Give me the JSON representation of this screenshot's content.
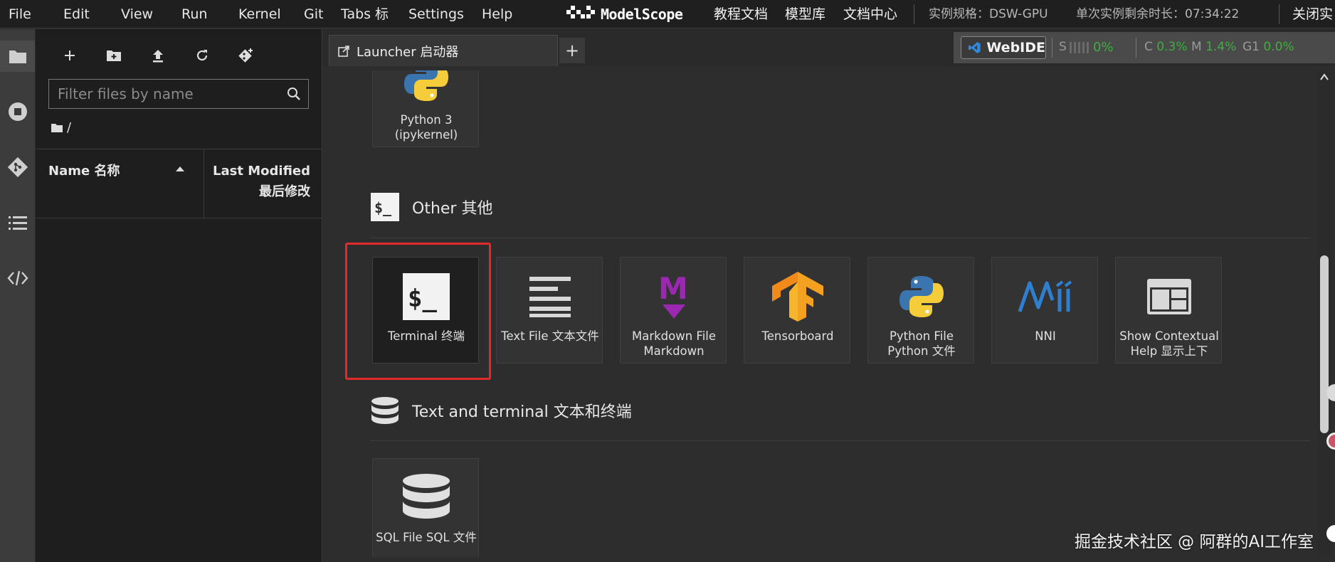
{
  "menubar": {
    "items": [
      "File",
      "Edit",
      "View",
      "Run",
      "Kernel",
      "Git",
      "Tabs",
      "标",
      "Settings",
      "Help"
    ],
    "brand": "ModelScope",
    "links": [
      "教程文档",
      "模型库",
      "文档中心"
    ],
    "instance_spec": "实例规格：DSW-GPU",
    "time_left": "单次实例剩余时长：07:34:22",
    "close_label": "关闭实"
  },
  "filebrowser": {
    "filter_placeholder": "Filter files by name",
    "breadcrumb": "/",
    "col_name": "Name  名称",
    "col_modified": "Last Modified  最后修改"
  },
  "tab": {
    "label": "Launcher  启动器",
    "add": "+"
  },
  "status": {
    "webide": "WebIDE",
    "s_label": "S",
    "s_value": "0%",
    "c_label": "C",
    "c_value": "0.3%",
    "m_label": "M",
    "m_value": "1.4%",
    "g_label": "G1",
    "g_value": "0.0%"
  },
  "launcher": {
    "notebook_card": "Python 3 (ipykernel)",
    "other_section": "Other  其他",
    "other_cards": [
      "Terminal  终端",
      "Text File  文本文件",
      "Markdown File  Markdown",
      "Tensorboard",
      "Python File  Python 文件",
      "NNI",
      "Show Contextual Help  显示上下"
    ],
    "text_terminal_section": "Text and terminal  文本和终端",
    "sql_card": "SQL File  SQL 文件"
  },
  "watermark": "掘金技术社区 @ 阿群的AI工作室",
  "colors": {
    "accent_green": "#3fae3f",
    "highlight_red": "#e12b2b",
    "tensorflow_orange": "#f4a020",
    "markdown_purple": "#9b28b0",
    "python_blue": "#3a75b0",
    "python_yellow": "#f5cc3a",
    "nni_blue": "#2f7fd0"
  }
}
